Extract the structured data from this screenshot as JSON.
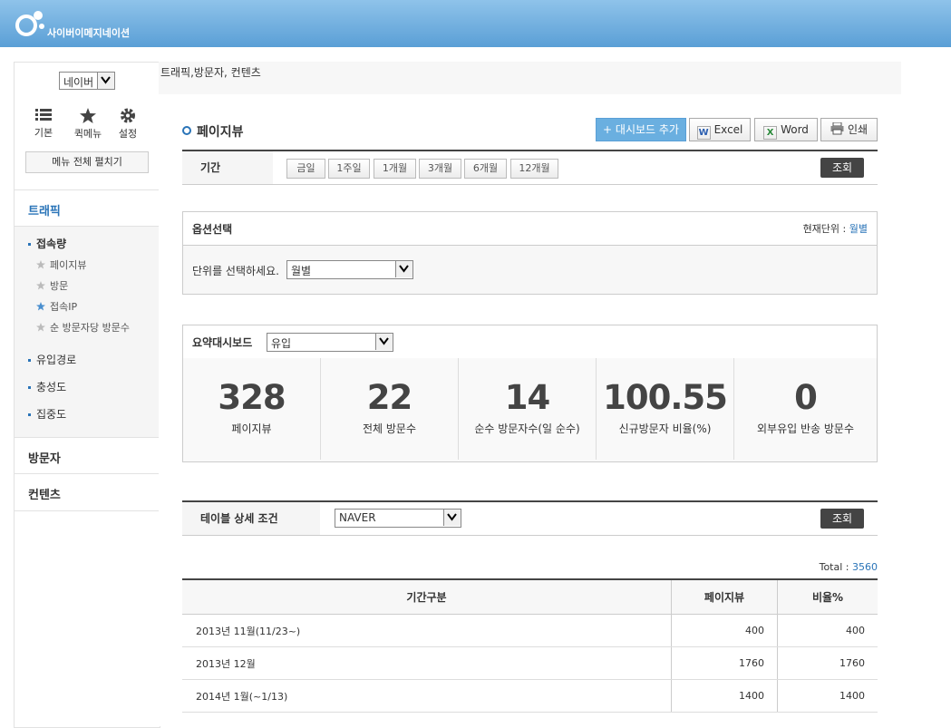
{
  "header": {
    "logo_text": "사이버이메지네이션",
    "colors": {
      "bar": "#6aaee0",
      "accent": "#2a74b8"
    }
  },
  "sidebar": {
    "engine_select": "네이버",
    "quick": [
      {
        "label": "기본",
        "icon": "list-icon"
      },
      {
        "label": "퀵메뉴",
        "icon": "star-icon"
      },
      {
        "label": "설정",
        "icon": "gear-icon"
      }
    ],
    "expand_label": "메뉴 전체 펼치기",
    "traffic": "트래픽",
    "access": "접속량",
    "leaves": [
      "페이지뷰",
      "방문",
      "접속IP",
      "순 방문자당 방문수"
    ],
    "inflow": "유입경로",
    "loyalty": "충성도",
    "focus": "집중도",
    "visitors": "방문자",
    "contents": "컨텐츠"
  },
  "breadcrumb": "트래픽,방문자, 컨텐츠",
  "page_title": "페이지뷰",
  "toolbar": {
    "dashboard": "+ 대시보드 추가",
    "excel": "Excel",
    "word": "Word",
    "print": "인쇄"
  },
  "period": {
    "label": "기간",
    "options": [
      "금일",
      "1주일",
      "1개월",
      "3개월",
      "6개월",
      "12개월"
    ],
    "search": "조회"
  },
  "options": {
    "title": "옵션선택",
    "unit_prefix": "현재단위 :",
    "unit_value": "월별",
    "prompt": "단위를 선택하세요.",
    "unit_select": "월별"
  },
  "summary": {
    "title": "요약대시보드",
    "select": "유입",
    "stats": [
      {
        "value": "328",
        "label": "페이지뷰"
      },
      {
        "value": "22",
        "label": "전체 방문수"
      },
      {
        "value": "14",
        "label": "순수 방문자수(일 순수)"
      },
      {
        "value": "100.55",
        "label": "신규방문자 비율(%)"
      },
      {
        "value": "0",
        "label": "외부유입 반송 방문수"
      }
    ]
  },
  "table_condition": {
    "label": "테이블 상세 조건",
    "select": "NAVER",
    "search": "조회"
  },
  "total": {
    "label": "Total :",
    "value": "3560"
  },
  "table": {
    "columns": [
      "기간구분",
      "페이지뷰",
      "비율%"
    ],
    "rows": [
      [
        "2013년 11월(11/23~)",
        "400",
        "400"
      ],
      [
        "2013년 12월",
        "1760",
        "1760"
      ],
      [
        "2014년 1월(~1/13)",
        "1400",
        "1400"
      ]
    ]
  }
}
